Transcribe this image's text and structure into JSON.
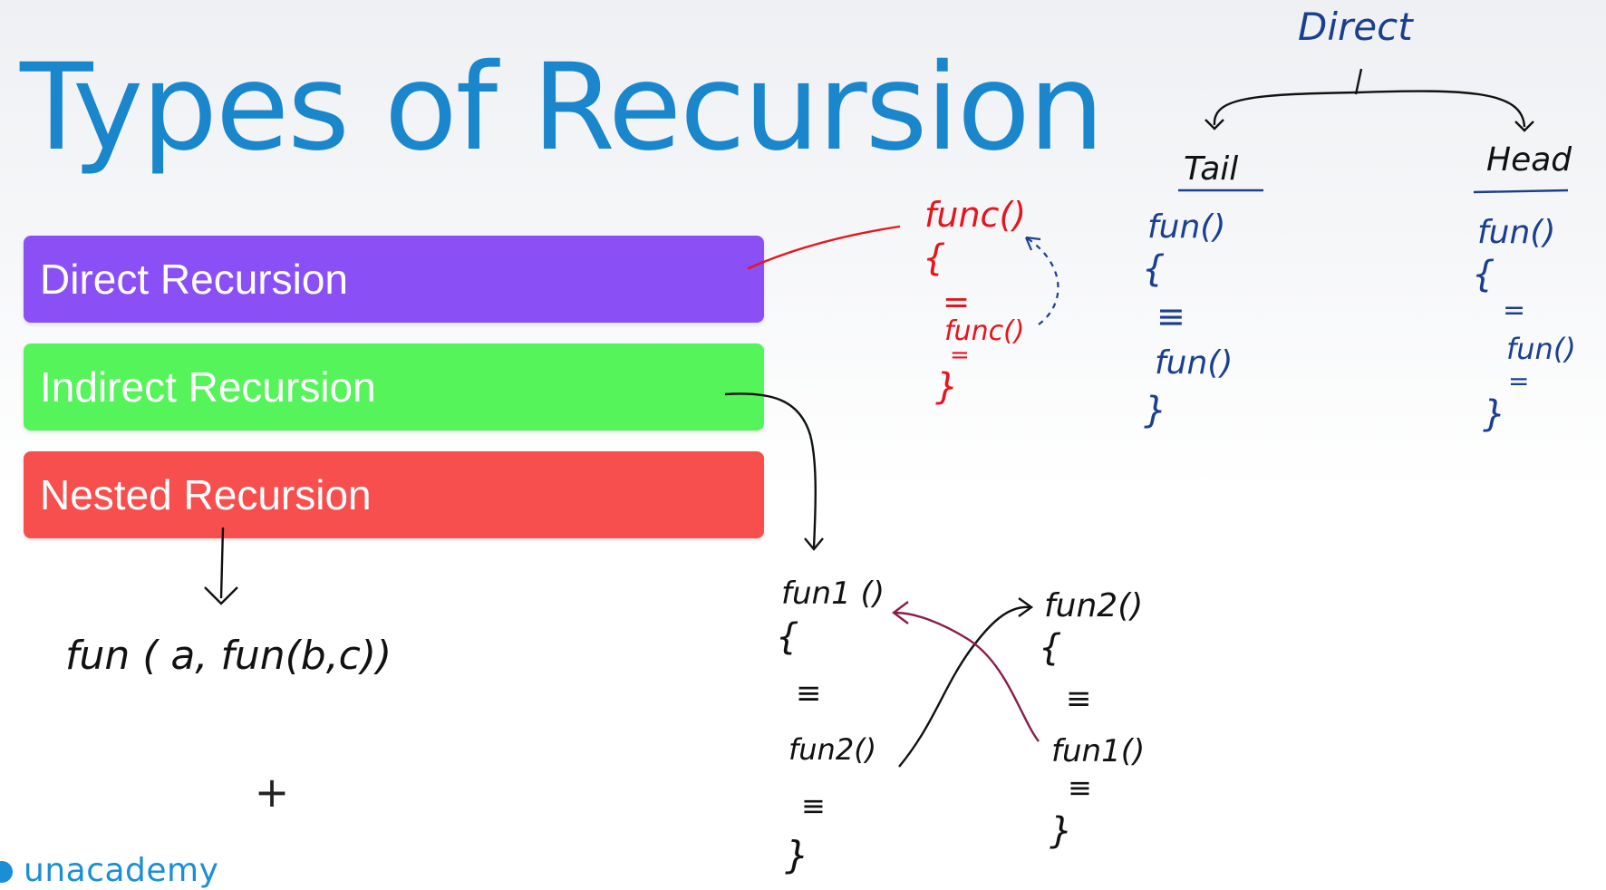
{
  "slide": {
    "title": "Types of Recursion",
    "bars": [
      {
        "label": "Direct Recursion",
        "color": "#8a50f5"
      },
      {
        "label": "Indirect Recursion",
        "color": "#55f45a"
      },
      {
        "label": "Nested Recursion",
        "color": "#f74e4e"
      }
    ],
    "brand": "unacademy"
  },
  "annotations": {
    "ink_colors": {
      "red": "#e8141c",
      "blue": "#1b3f8f",
      "black": "#111111",
      "maroon": "#8a1c4a"
    },
    "direct_example": {
      "header": "func()",
      "open": "{",
      "rule": "=",
      "call": "func()",
      "rule2": "=",
      "close": "}"
    },
    "direct_tree": {
      "root": "Direct",
      "left": {
        "heading": "Tail",
        "header": "fun()",
        "open": "{",
        "rule": "≡",
        "call": "fun()",
        "close": "}"
      },
      "right": {
        "heading": "Head",
        "header": "fun()",
        "open": "{",
        "rule": "=",
        "call": "fun()",
        "rule2": "=",
        "close": "}"
      }
    },
    "indirect_example": {
      "left": {
        "header": "fun1 ()",
        "open": "{",
        "rule": "≡",
        "call": "fun2()",
        "rule2": "≡",
        "close": "}"
      },
      "right": {
        "header": "fun2()",
        "open": "{",
        "rule": "≡",
        "call": "fun1()",
        "rule2": "≡",
        "close": "}"
      }
    },
    "nested_example": {
      "expression": "fun ( a, fun(b,c))"
    }
  },
  "cursor": {
    "icon": "crosshair-icon",
    "glyph": "+"
  }
}
